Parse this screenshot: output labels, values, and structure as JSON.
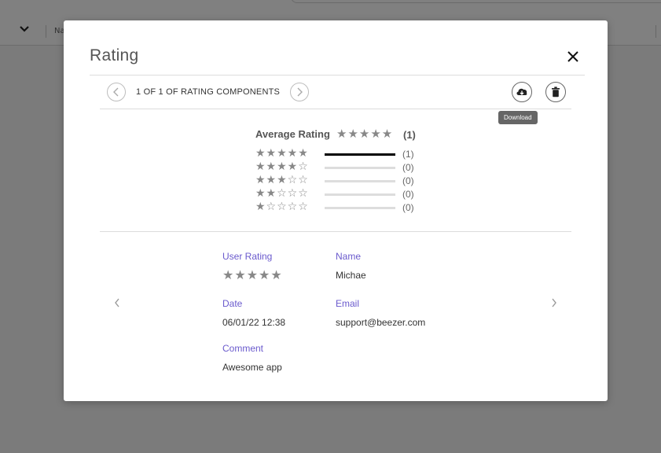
{
  "backdrop": {
    "column_label": "Na"
  },
  "modal": {
    "title": "Rating",
    "pager": {
      "text": "1 OF 1 OF RATING COMPONENTS"
    },
    "tooltip": "Download",
    "summary": {
      "label": "Average Rating",
      "stars": "★★★★★",
      "count": "(1)",
      "distribution": [
        {
          "stars": "★★★★★",
          "count": "(1)",
          "fill": 1.0
        },
        {
          "stars": "★★★★☆",
          "count": "(0)",
          "fill": 0
        },
        {
          "stars": "★★★☆☆",
          "count": "(0)",
          "fill": 0
        },
        {
          "stars": "★★☆☆☆",
          "count": "(0)",
          "fill": 0
        },
        {
          "stars": "★☆☆☆☆",
          "count": "(0)",
          "fill": 0
        }
      ]
    },
    "detail": {
      "user_rating_label": "User Rating",
      "user_rating_stars": "★★★★★",
      "name_label": "Name",
      "name_value": "Michae",
      "date_label": "Date",
      "date_value": "06/01/22 12:38",
      "email_label": "Email",
      "email_value": "support@beezer.com",
      "comment_label": "Comment",
      "comment_value": "Awesome app"
    }
  },
  "colors": {
    "accent": "#6a5acd",
    "overlay": "#7b7b7b"
  },
  "icons": {
    "close": "close-icon",
    "download": "cloud-download-icon",
    "delete": "trash-icon",
    "prev": "chevron-left-icon",
    "next": "chevron-right-icon"
  }
}
